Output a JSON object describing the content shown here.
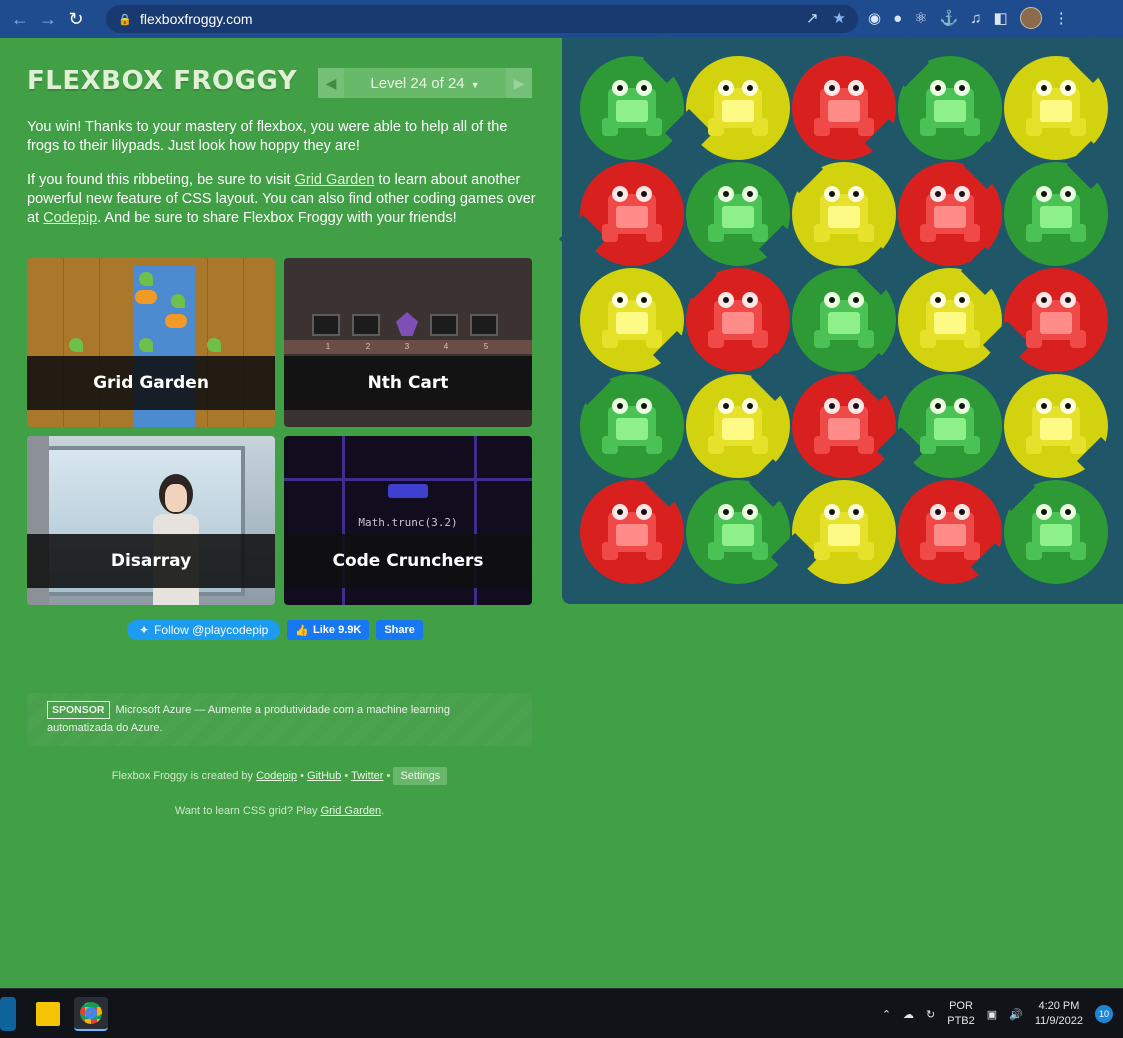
{
  "browser": {
    "url": "flexboxfroggy.com"
  },
  "header": {
    "title": "FLEXBOX FROGGY",
    "level_label": "Level 24 of 24"
  },
  "intro": {
    "p1": "You win! Thanks to your mastery of flexbox, you were able to help all of the frogs to their lilypads. Just look how hoppy they are!",
    "p2_before": "If you found this ribbeting, be sure to visit ",
    "p2_link1": "Grid Garden",
    "p2_middle": " to learn about another powerful new feature of CSS layout. You can also find other coding games over at ",
    "p2_link2": "Codepip",
    "p2_after": ". And be sure to share Flexbox Froggy with your friends!"
  },
  "games": [
    {
      "title": "Grid Garden"
    },
    {
      "title": "Nth Cart",
      "cart_numbers": [
        "1",
        "2",
        "3",
        "4",
        "5"
      ]
    },
    {
      "title": "Disarray"
    },
    {
      "title": "Code Crunchers",
      "code": "Math.trunc(3.2)"
    }
  ],
  "social": {
    "twitter": "Follow @playcodepip",
    "fb_like": "Like 9.9K",
    "fb_share": "Share"
  },
  "sponsor": {
    "tag": "SPONSOR",
    "text": "Microsoft Azure — Aumente a produtividade com a machine learning automatizada do Azure."
  },
  "footer": {
    "created_by": "Flexbox Froggy is created by",
    "codepip": "Codepip",
    "github": "GitHub",
    "twitter": "Twitter",
    "settings": "Settings",
    "learn_text": "Want to learn CSS grid? Play",
    "grid_garden": "Grid Garden",
    "period": "."
  },
  "pond": {
    "rows": [
      [
        "green",
        "yellow",
        "red",
        "green",
        "yellow"
      ],
      [
        "red",
        "green",
        "yellow",
        "red",
        "green"
      ],
      [
        "yellow",
        "red",
        "green",
        "yellow",
        "red"
      ],
      [
        "green",
        "yellow",
        "red",
        "green",
        "yellow"
      ],
      [
        "red",
        "green",
        "yellow",
        "red",
        "green"
      ]
    ],
    "colors": {
      "green": {
        "pad": "#2e9a36",
        "body": "#4bc255",
        "belly": "#8ef088",
        "eye": "#e8ffe0"
      },
      "yellow": {
        "pad": "#d3d20f",
        "body": "#e6e22c",
        "belly": "#fdfa86",
        "eye": "#ffffe0"
      },
      "red": {
        "pad": "#d8201e",
        "body": "#ef4a47",
        "belly": "#ff8c88",
        "eye": "#ffe6e6"
      }
    }
  },
  "taskbar": {
    "lang1": "POR",
    "lang2": "PTB2",
    "time": "4:20 PM",
    "date": "11/9/2022",
    "notifications": "10"
  },
  "colors": {
    "page_bg": "#41a046",
    "pond_bg": "#1f5768",
    "chrome_bg": "#1f4b8f"
  }
}
